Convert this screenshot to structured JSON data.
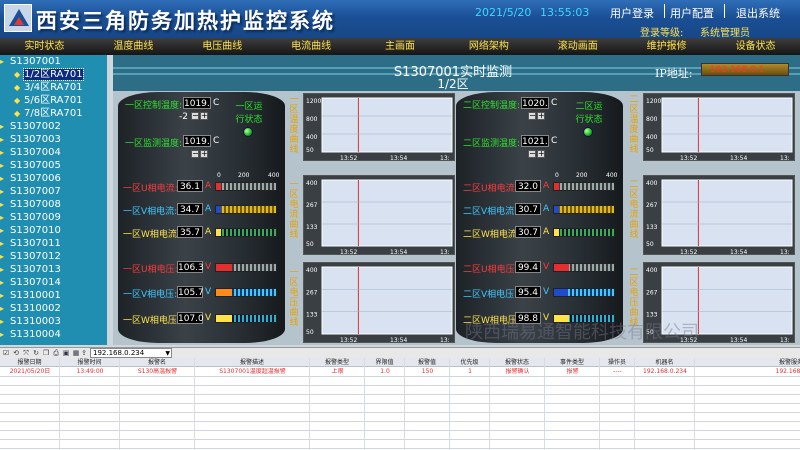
{
  "header": {
    "title": "西安三角防务加热护监控系统",
    "date": "2021/5/20",
    "time": "13:55:03",
    "links": [
      "用户登录",
      "用户配置",
      "退出系统"
    ],
    "login_level_label": "登录等级:",
    "login_level_value": "系统管理员"
  },
  "nav": [
    "实时状态",
    "温度曲线",
    "电压曲线",
    "电流曲线",
    "主画面",
    "网络架构",
    "滚动画面",
    "维护报修",
    "设备状态"
  ],
  "tree": [
    {
      "label": "S1307001",
      "level": 0
    },
    {
      "label": "1/2区RA701",
      "level": 1,
      "selected": true
    },
    {
      "label": "3/4区RA701",
      "level": 1
    },
    {
      "label": "5/6区RA701",
      "level": 1
    },
    {
      "label": "7/8区RA701",
      "level": 1
    },
    {
      "label": "S1307002",
      "level": 0
    },
    {
      "label": "S1307003",
      "level": 0
    },
    {
      "label": "S1307004",
      "level": 0
    },
    {
      "label": "S1307005",
      "level": 0
    },
    {
      "label": "S1307006",
      "level": 0
    },
    {
      "label": "S1307007",
      "level": 0
    },
    {
      "label": "S1307008",
      "level": 0
    },
    {
      "label": "S1307009",
      "level": 0
    },
    {
      "label": "S1307010",
      "level": 0
    },
    {
      "label": "S1307011",
      "level": 0
    },
    {
      "label": "S1307012",
      "level": 0
    },
    {
      "label": "S1307013",
      "level": 0
    },
    {
      "label": "S1307014",
      "level": 0
    },
    {
      "label": "S1310001",
      "level": 0
    },
    {
      "label": "S1310002",
      "level": 0
    },
    {
      "label": "S1310003",
      "level": 0
    },
    {
      "label": "S1310004",
      "level": 0
    }
  ],
  "main": {
    "title": "S1307001实时监测",
    "subtitle": "1/2区",
    "ip_label": "IP地址:",
    "ip_value": "192.168.0.1",
    "zone1": {
      "ctrl_temp_label": "一区控制温度:",
      "ctrl_temp_value": "1019.",
      "ctrl_temp_unit": "C",
      "ctrl_offset": "-2",
      "run_state_label": "一区运行状态",
      "mon_temp_label": "一区监测温度:",
      "mon_temp_value": "1019.",
      "mon_temp_unit": "C",
      "i_u_label": "一区U相电流:",
      "i_u_value": "36.1",
      "i_v_label": "一区V相电流:",
      "i_v_value": "34.7",
      "i_w_label": "一区W相电流:",
      "i_w_value": "35.7",
      "v_u_label": "一区U相电压:",
      "v_u_value": "106.3",
      "v_v_label": "一区V相电压:",
      "v_v_value": "105.7",
      "v_w_label": "一区W相电压:",
      "v_w_value": "107.0",
      "amp_unit": "A",
      "volt_unit": "V",
      "scale": [
        "0",
        "200",
        "400"
      ]
    },
    "zone2": {
      "ctrl_temp_label": "二区控制温度:",
      "ctrl_temp_value": "1020.",
      "ctrl_temp_unit": "C",
      "run_state_label": "二区运行状态",
      "mon_temp_label": "二区监测温度:",
      "mon_temp_value": "1021.",
      "mon_temp_unit": "C",
      "i_u_label": "二区U相电流:",
      "i_u_value": "32.0",
      "i_v_label": "二区V相电流:",
      "i_v_value": "30.7",
      "i_w_label": "二区W相电流:",
      "i_w_value": "30.7",
      "v_u_label": "二区U相电压:",
      "v_u_value": "99.4",
      "v_v_label": "二区V相电压:",
      "v_v_value": "95.4",
      "v_w_label": "二区W相电压:",
      "v_w_value": "98.8",
      "amp_unit": "A",
      "volt_unit": "V",
      "scale": [
        "0",
        "200",
        "400"
      ]
    },
    "chart_labels": {
      "z1_temp": "一区温度曲线",
      "z1_current": "一区电流曲线",
      "z1_voltage": "一区电压曲线",
      "z2_temp": "二区温度曲线",
      "z2_current": "二区电流曲线",
      "z2_voltage": "二区电压曲线"
    },
    "z1_current_bars": [
      0.09,
      0.087,
      0.089
    ],
    "z1_voltage_bars": [
      0.266,
      0.264,
      0.268
    ],
    "z2_current_bars": [
      0.08,
      0.077,
      0.077
    ],
    "z2_voltage_bars": [
      0.249,
      0.239,
      0.247
    ]
  },
  "chart_data": [
    {
      "type": "line",
      "title": "",
      "xlabel": "",
      "ylabel": "",
      "x_ticks": [
        "13:52",
        "13:54",
        "13:"
      ],
      "y_ticks": [
        "1200",
        "800",
        "400",
        "50"
      ],
      "ylim": [
        50,
        1200
      ],
      "series": [
        {
          "values": []
        }
      ]
    },
    {
      "type": "line",
      "title": "",
      "xlabel": "",
      "ylabel": "",
      "x_ticks": [
        "13:52",
        "13:54",
        "13:"
      ],
      "y_ticks": [
        "400",
        "267",
        "133",
        "50"
      ],
      "ylim": [
        50,
        400
      ],
      "series": [
        {
          "values": []
        }
      ]
    },
    {
      "type": "line",
      "title": "",
      "xlabel": "",
      "ylabel": "",
      "x_ticks": [
        "13:52",
        "13:54",
        "13:"
      ],
      "y_ticks": [
        "400",
        "267",
        "133",
        "50"
      ],
      "ylim": [
        50,
        400
      ],
      "series": [
        {
          "values": []
        }
      ]
    },
    {
      "type": "line",
      "title": "",
      "xlabel": "",
      "ylabel": "",
      "x_ticks": [
        "13:52",
        "13:54",
        "13:"
      ],
      "y_ticks": [
        "1200",
        "800",
        "400",
        "50"
      ],
      "ylim": [
        50,
        1200
      ],
      "series": [
        {
          "values": []
        }
      ]
    },
    {
      "type": "line",
      "title": "",
      "xlabel": "",
      "ylabel": "",
      "x_ticks": [
        "13:52",
        "13:54",
        "13:"
      ],
      "y_ticks": [
        "400",
        "267",
        "133",
        "50"
      ],
      "ylim": [
        50,
        400
      ],
      "series": [
        {
          "values": []
        }
      ]
    },
    {
      "type": "line",
      "title": "",
      "xlabel": "",
      "ylabel": "",
      "x_ticks": [
        "13:52",
        "13:54",
        "13:"
      ],
      "y_ticks": [
        "400",
        "267",
        "133",
        "50"
      ],
      "ylim": [
        50,
        400
      ],
      "series": [
        {
          "values": []
        }
      ]
    }
  ],
  "toolbar": {
    "icons": [
      "checkbox-icon",
      "reset-icon",
      "expand-icon",
      "refresh-icon",
      "copy-icon",
      "print-icon",
      "save-icon",
      "table-icon",
      "export-icon"
    ],
    "ip_select": "192.168.0.234"
  },
  "grid": {
    "headers": [
      "报警日期",
      "报警时间",
      "报警名",
      "报警描述",
      "报警类型",
      "界限值",
      "报警值",
      "优先级",
      "报警状态",
      "事件类型",
      "操作员",
      "机器名",
      "报警服务器名"
    ],
    "rows": [
      [
        "2021/05/20日",
        "13:49:00",
        "S130高温报警",
        "S1307001温度超温报警",
        "上限",
        "1.0",
        "150",
        "1",
        "报警确认",
        "报警",
        "----",
        "192.168.0.234",
        "192.168.0.234"
      ]
    ]
  },
  "watermark": "陕西瑞易通智能科技有限公司",
  "colors": {
    "header": "#1b4f96",
    "tree": "#1f8eb0",
    "chart_bg": "#d8e2f0",
    "alarm_text": "#e23030"
  }
}
